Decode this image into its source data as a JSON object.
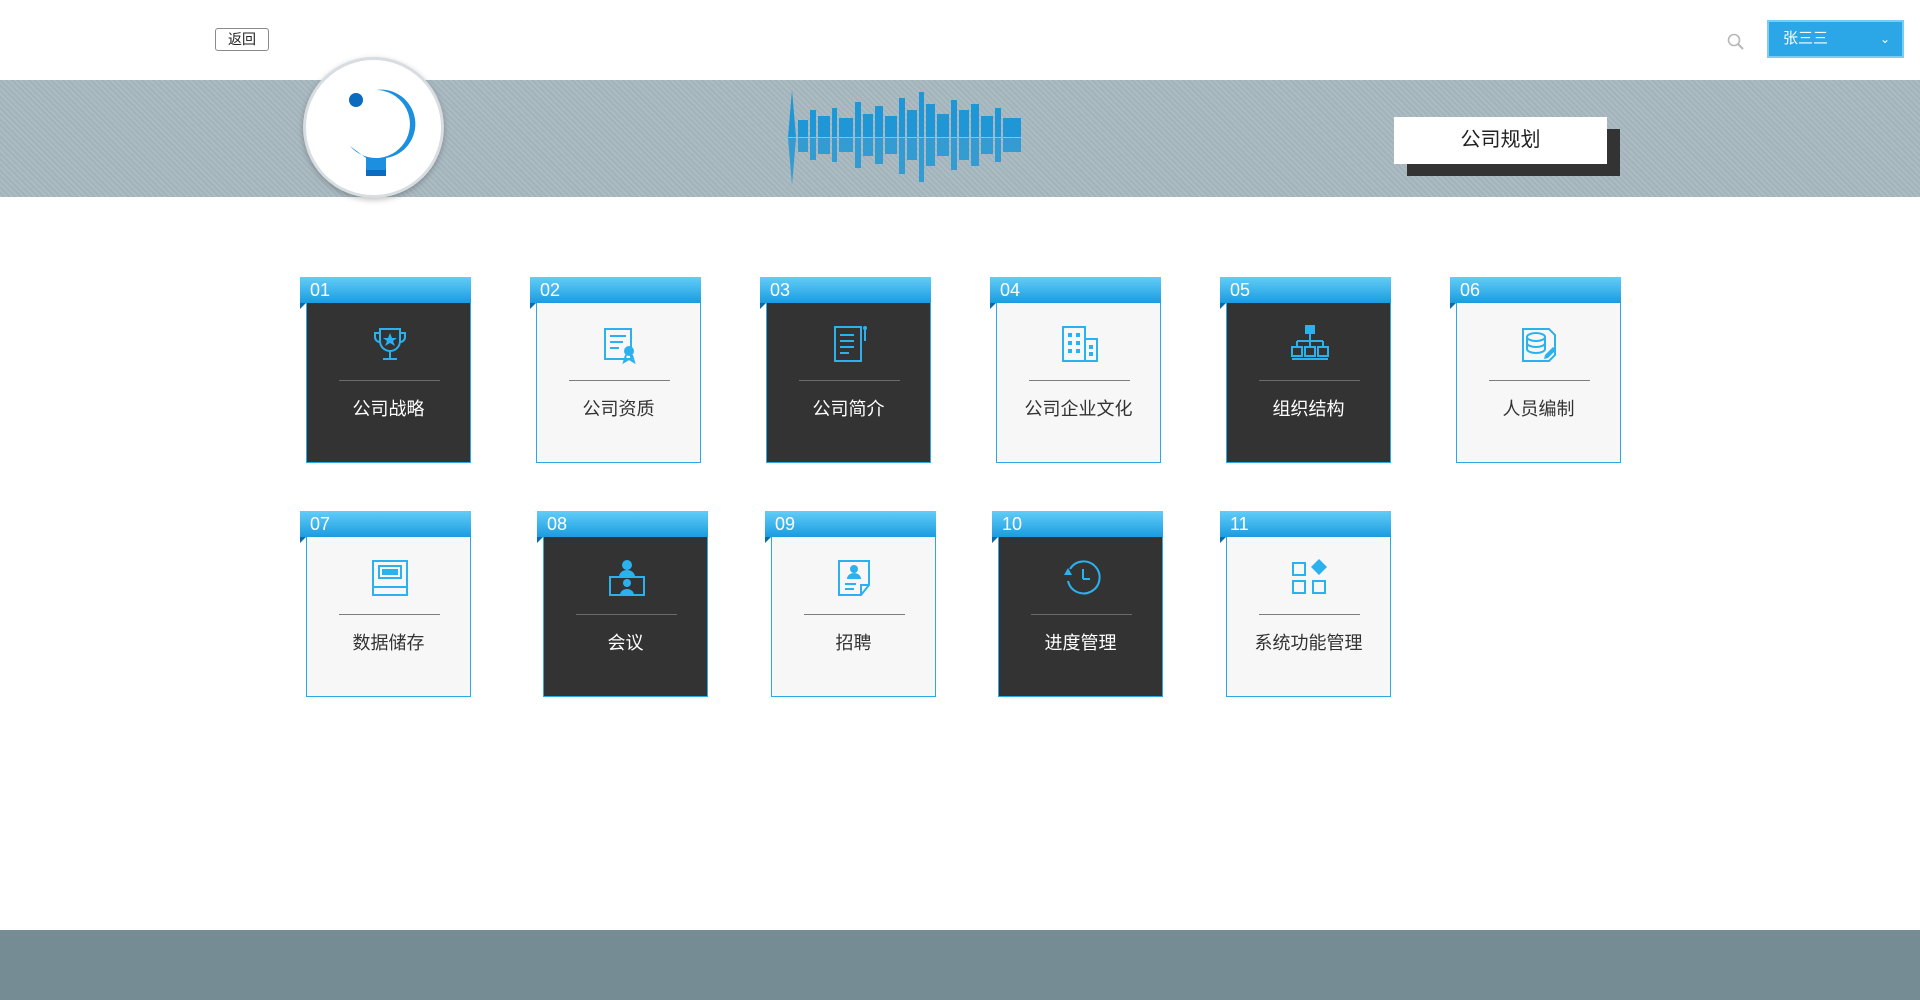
{
  "header": {
    "back_label": "返回",
    "user_name": "张三三",
    "search_icon": "search-icon",
    "accent": "#2ba6e6"
  },
  "banner": {
    "section_title": "公司规划"
  },
  "tiles": [
    {
      "num": "01",
      "label": "公司战略",
      "icon": "trophy-icon",
      "theme": "dark"
    },
    {
      "num": "02",
      "label": "公司资质",
      "icon": "certificate-icon",
      "theme": "light"
    },
    {
      "num": "03",
      "label": "公司简介",
      "icon": "document-icon",
      "theme": "dark"
    },
    {
      "num": "04",
      "label": "公司企业文化",
      "icon": "building-icon",
      "theme": "light"
    },
    {
      "num": "05",
      "label": "组织结构",
      "icon": "org-chart-icon",
      "theme": "dark"
    },
    {
      "num": "06",
      "label": "人员编制",
      "icon": "database-edit-icon",
      "theme": "light"
    },
    {
      "num": "07",
      "label": "数据储存",
      "icon": "storage-icon",
      "theme": "light"
    },
    {
      "num": "08",
      "label": "会议",
      "icon": "meeting-icon",
      "theme": "dark"
    },
    {
      "num": "09",
      "label": "招聘",
      "icon": "recruit-icon",
      "theme": "light"
    },
    {
      "num": "10",
      "label": "进度管理",
      "icon": "history-icon",
      "theme": "dark"
    },
    {
      "num": "11",
      "label": "系统功能管理",
      "icon": "apps-icon",
      "theme": "light"
    }
  ]
}
